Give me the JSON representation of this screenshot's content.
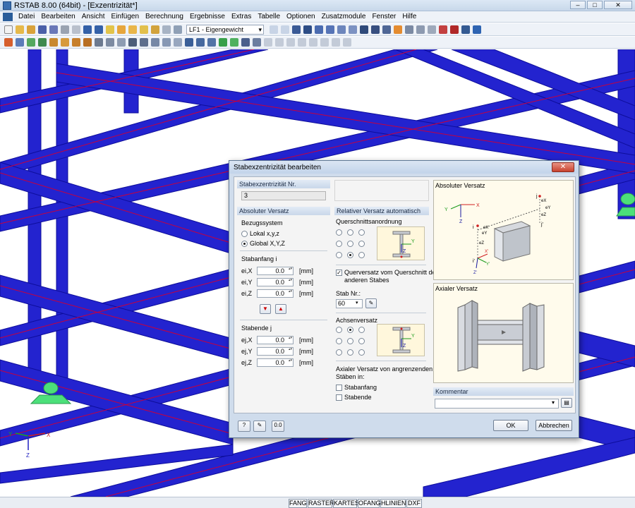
{
  "window": {
    "title": "RSTAB 8.00 (64bit) - [Exzentrizität*]",
    "btn_min": "–",
    "btn_max": "□",
    "btn_close": "✕"
  },
  "menu": [
    "Datei",
    "Bearbeiten",
    "Ansicht",
    "Einfügen",
    "Berechnung",
    "Ergebnisse",
    "Extras",
    "Tabelle",
    "Optionen",
    "Zusatzmodule",
    "Fenster",
    "Hilfe"
  ],
  "toolbar": {
    "loadcase": "LF1 - Eigengewicht"
  },
  "statusbar": [
    "FANG",
    "RASTER",
    "KARTES",
    "OFANG",
    "HLINIEN",
    "DXF"
  ],
  "axis_triad": {
    "x": "X",
    "y": "Y",
    "z": "Z"
  },
  "dialog": {
    "title": "Stabexzentrizität bearbeiten",
    "close": "✕",
    "nr_group": {
      "header": "Stabexzentrizität Nr.",
      "value": "3"
    },
    "abs": {
      "header": "Absoluter Versatz",
      "ref_label": "Bezugssystem",
      "opt_local": "Lokal x,y,z",
      "opt_global": "Global X,Y,Z",
      "start_label": "Stabanfang i",
      "end_label": "Stabende j",
      "start_rows": [
        {
          "name": "ei,X",
          "value": "0.0",
          "unit": "[mm]"
        },
        {
          "name": "ei,Y",
          "value": "0.0",
          "unit": "[mm]"
        },
        {
          "name": "ei,Z",
          "value": "0.0",
          "unit": "[mm]"
        }
      ],
      "end_rows": [
        {
          "name": "ej,X",
          "value": "0.0",
          "unit": "[mm]"
        },
        {
          "name": "ej,Y",
          "value": "0.0",
          "unit": "[mm]"
        },
        {
          "name": "ej,Z",
          "value": "0.0",
          "unit": "[mm]"
        }
      ]
    },
    "rel": {
      "header": "Relativer Versatz automatisch",
      "xsec_label": "Querschnittsanordnung",
      "cb_cross": "Querversatz vom Querschnitt des",
      "cb_cross2": "anderen Stabes",
      "bar_label": "Stab Nr.:",
      "bar_value": "60",
      "axis_label": "Achsenversatz",
      "axial_label": "Axialer Versatz von angrenzenden",
      "axial_label2": "Stäben in:",
      "cb_start": "Stabanfang",
      "cb_end": "Stabende"
    },
    "img_abs": {
      "header": "Absoluter Versatz",
      "ax_y": "Y",
      "ax_x": "X",
      "ax_z": "Z",
      "j": "j",
      "ex": "eX",
      "ey": "eY",
      "ez": "eZ",
      "jprime": "j'",
      "i": "i",
      "iprime": "i'",
      "xprime": "X'",
      "yprime": "Y'",
      "zprime": "Z'",
      "ex_i": "eX",
      "ey_i": "eY",
      "ez_i": "eZ"
    },
    "img_axial": {
      "header": "Axialer Versatz"
    },
    "comment": {
      "header": "Kommentar",
      "value": ""
    },
    "ok": "OK",
    "cancel": "Abbrechen",
    "xsec_marks": {
      "y": "Y",
      "z": "Z"
    }
  },
  "colors": {
    "member": "#2323cf",
    "member_dark": "#0d0d9a",
    "dialog_bg": "#cfdcec",
    "support": "#4ce07a"
  }
}
